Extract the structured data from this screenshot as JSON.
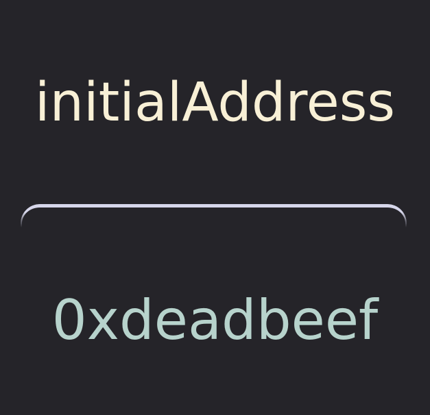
{
  "variable": {
    "name": "initialAddress",
    "value": "0xdeadbeef"
  },
  "colors": {
    "background": "#252429",
    "name_text": "#f8f0d6",
    "value_text": "#b7d3cc",
    "divider": "#d6d6ea"
  }
}
